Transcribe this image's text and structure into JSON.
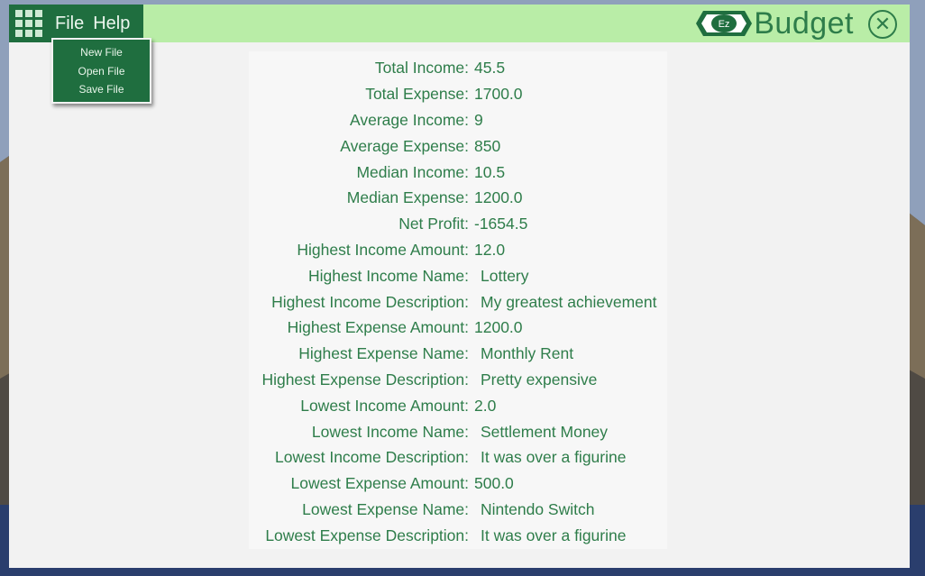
{
  "menu": {
    "file_label": "File",
    "help_label": "Help",
    "file_items": [
      "New File",
      "Open File",
      "Save File"
    ]
  },
  "brand": {
    "logo_text": "Ez",
    "title": "Budget"
  },
  "icons": {
    "menu": "grid-icon",
    "close": "close-icon",
    "logo": "money-bill-icon"
  },
  "colors": {
    "accent_dark": "#1f6e3f",
    "accent_light": "#b9eda7",
    "text": "#2e7d4a"
  },
  "stats": [
    {
      "label": "Total Income:",
      "value": "45.5"
    },
    {
      "label": "Total Expense:",
      "value": "1700.0"
    },
    {
      "label": "Average Income:",
      "value": "9"
    },
    {
      "label": "Average Expense:",
      "value": "850"
    },
    {
      "label": "Median Income:",
      "value": "10.5"
    },
    {
      "label": "Median Expense:",
      "value": "1200.0"
    },
    {
      "label": "Net Profit:",
      "value": "-1654.5"
    },
    {
      "label": "Highest Income Amount:",
      "value": "12.0"
    },
    {
      "label": "Highest Income Name:",
      "value": "Lottery"
    },
    {
      "label": "Highest Income Description:",
      "value": "My greatest achievement"
    },
    {
      "label": "Highest Expense Amount:",
      "value": "1200.0"
    },
    {
      "label": "Highest Expense Name:",
      "value": "Monthly Rent"
    },
    {
      "label": "Highest Expense Description:",
      "value": "Pretty expensive"
    },
    {
      "label": "Lowest Income Amount:",
      "value": "2.0"
    },
    {
      "label": "Lowest Income Name:",
      "value": "Settlement Money"
    },
    {
      "label": "Lowest Income Description:",
      "value": "It was over a figurine"
    },
    {
      "label": "Lowest Expense Amount:",
      "value": "500.0"
    },
    {
      "label": "Lowest Expense Name:",
      "value": "Nintendo Switch"
    },
    {
      "label": "Lowest Expense Description:",
      "value": "It was over a figurine"
    }
  ]
}
